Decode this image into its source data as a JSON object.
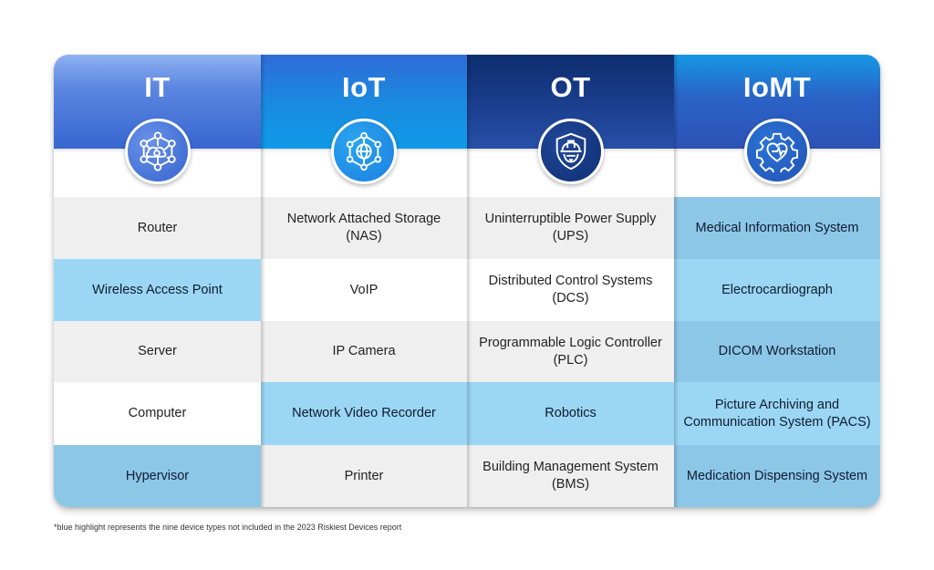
{
  "columns": [
    {
      "title": "IT",
      "icon": "network-hub-icon",
      "header_color": "#3766d0",
      "cells": [
        {
          "text": "Router",
          "highlighted": false
        },
        {
          "text": "Wireless Access Point",
          "highlighted": true
        },
        {
          "text": "Server",
          "highlighted": false
        },
        {
          "text": "Computer",
          "highlighted": false
        },
        {
          "text": "Hypervisor",
          "highlighted": true
        }
      ]
    },
    {
      "title": "IoT",
      "icon": "globe-network-icon",
      "header_color": "#1a8ae0",
      "cells": [
        {
          "text": "Network Attached Storage (NAS)",
          "highlighted": false
        },
        {
          "text": "VoIP",
          "highlighted": false
        },
        {
          "text": "IP Camera",
          "highlighted": false
        },
        {
          "text": "Network Video Recorder",
          "highlighted": true
        },
        {
          "text": "Printer",
          "highlighted": false
        }
      ]
    },
    {
      "title": "OT",
      "icon": "shield-hardhat-gear-icon",
      "header_color": "#1b3f8f",
      "cells": [
        {
          "text": "Uninterruptible Power Supply (UPS)",
          "highlighted": false
        },
        {
          "text": "Distributed Control Systems (DCS)",
          "highlighted": false
        },
        {
          "text": "Programmable Logic Controller (PLC)",
          "highlighted": false
        },
        {
          "text": "Robotics",
          "highlighted": true
        },
        {
          "text": "Building Management System (BMS)",
          "highlighted": false
        }
      ]
    },
    {
      "title": "IoMT",
      "icon": "gear-heartbeat-icon",
      "header_color": "#2a63c7",
      "cells": [
        {
          "text": "Medical Information System",
          "highlighted": true
        },
        {
          "text": "Electrocardiograph",
          "highlighted": true
        },
        {
          "text": "DICOM Workstation",
          "highlighted": true
        },
        {
          "text": "Picture Archiving and Communication System (PACS)",
          "highlighted": true
        },
        {
          "text": "Medication Dispensing System",
          "highlighted": true
        }
      ]
    }
  ],
  "colors": {
    "highlight_light": "#9bd6f4",
    "highlight_dark": "#8dc7e8",
    "row_gray": "#efefef",
    "row_white": "#ffffff"
  },
  "footnote": "*blue highlight represents the nine device types not included in the 2023 Riskiest Devices report"
}
